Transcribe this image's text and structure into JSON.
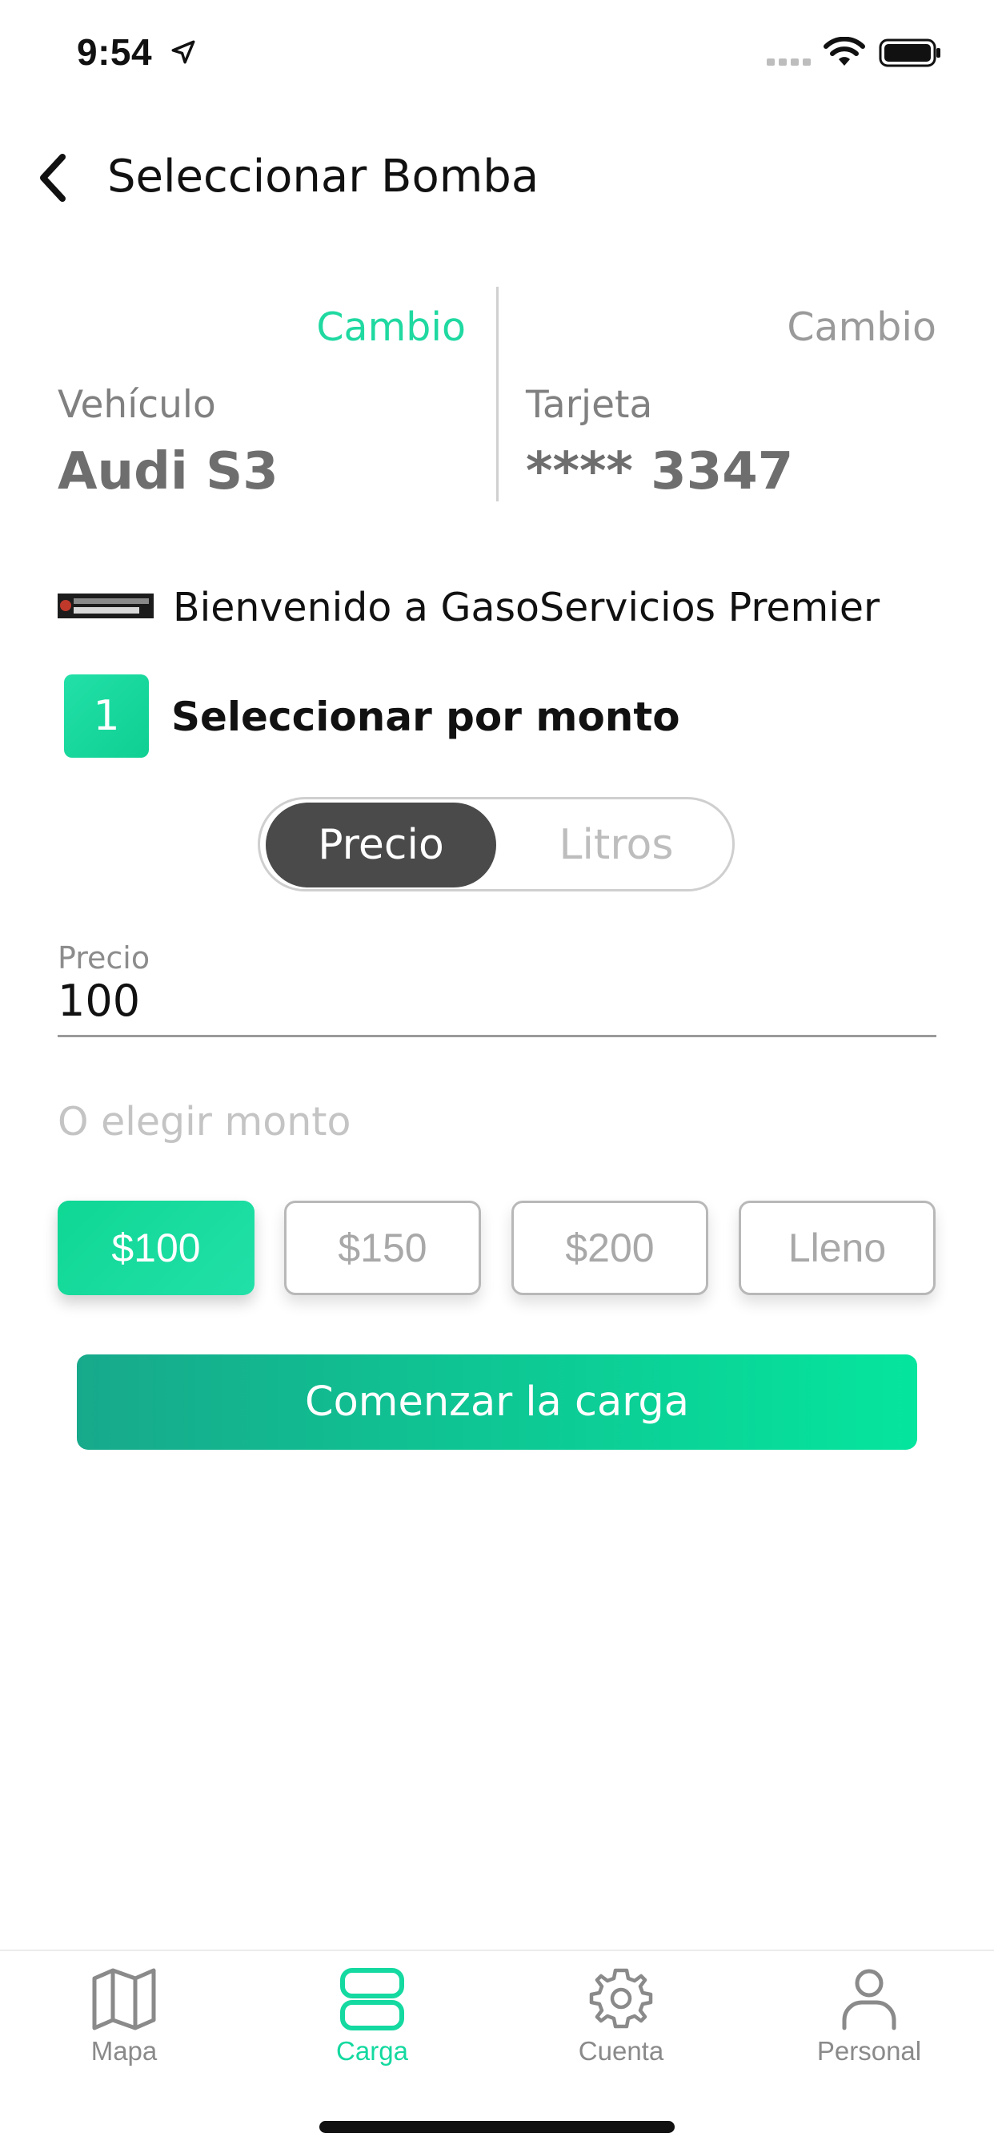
{
  "status_bar": {
    "time": "9:54",
    "icons": [
      "location-arrow-icon",
      "signal-icon",
      "wifi-icon",
      "battery-icon"
    ]
  },
  "header": {
    "back_icon": "chevron-left-icon",
    "title": "Seleccionar Bomba"
  },
  "vehicle": {
    "change_label": "Cambio",
    "label": "Vehículo",
    "value": "Audi S3"
  },
  "card": {
    "change_label": "Cambio",
    "label": "Tarjeta",
    "value": "**** 3347"
  },
  "station": {
    "logo_text": "GASOSERVICIOS PREMIER",
    "welcome": "Bienvenido a GasoServicios Premier"
  },
  "step": {
    "number": "1",
    "text": "Seleccionar por monto"
  },
  "segmented": {
    "options": [
      "Precio",
      "Litros"
    ],
    "selected": "Precio"
  },
  "amount_field": {
    "label": "Precio",
    "value": "100"
  },
  "or_text": "O elegir monto",
  "chips": {
    "items": [
      "$100",
      "$150",
      "$200",
      "Lleno"
    ],
    "selected": "$100"
  },
  "cta_label": "Comenzar la carga",
  "tabs": [
    {
      "label": "Mapa",
      "icon": "map-icon",
      "active": false
    },
    {
      "label": "Carga",
      "icon": "fuel-pump-icon",
      "active": true
    },
    {
      "label": "Cuenta",
      "icon": "gear-icon",
      "active": false
    },
    {
      "label": "Personal",
      "icon": "user-icon",
      "active": false
    }
  ],
  "colors": {
    "accent": "#1fd9a1",
    "accent_dark": "#17a98b",
    "segment_active": "#4a4a4a",
    "inactive_text": "#9a9a9a"
  }
}
